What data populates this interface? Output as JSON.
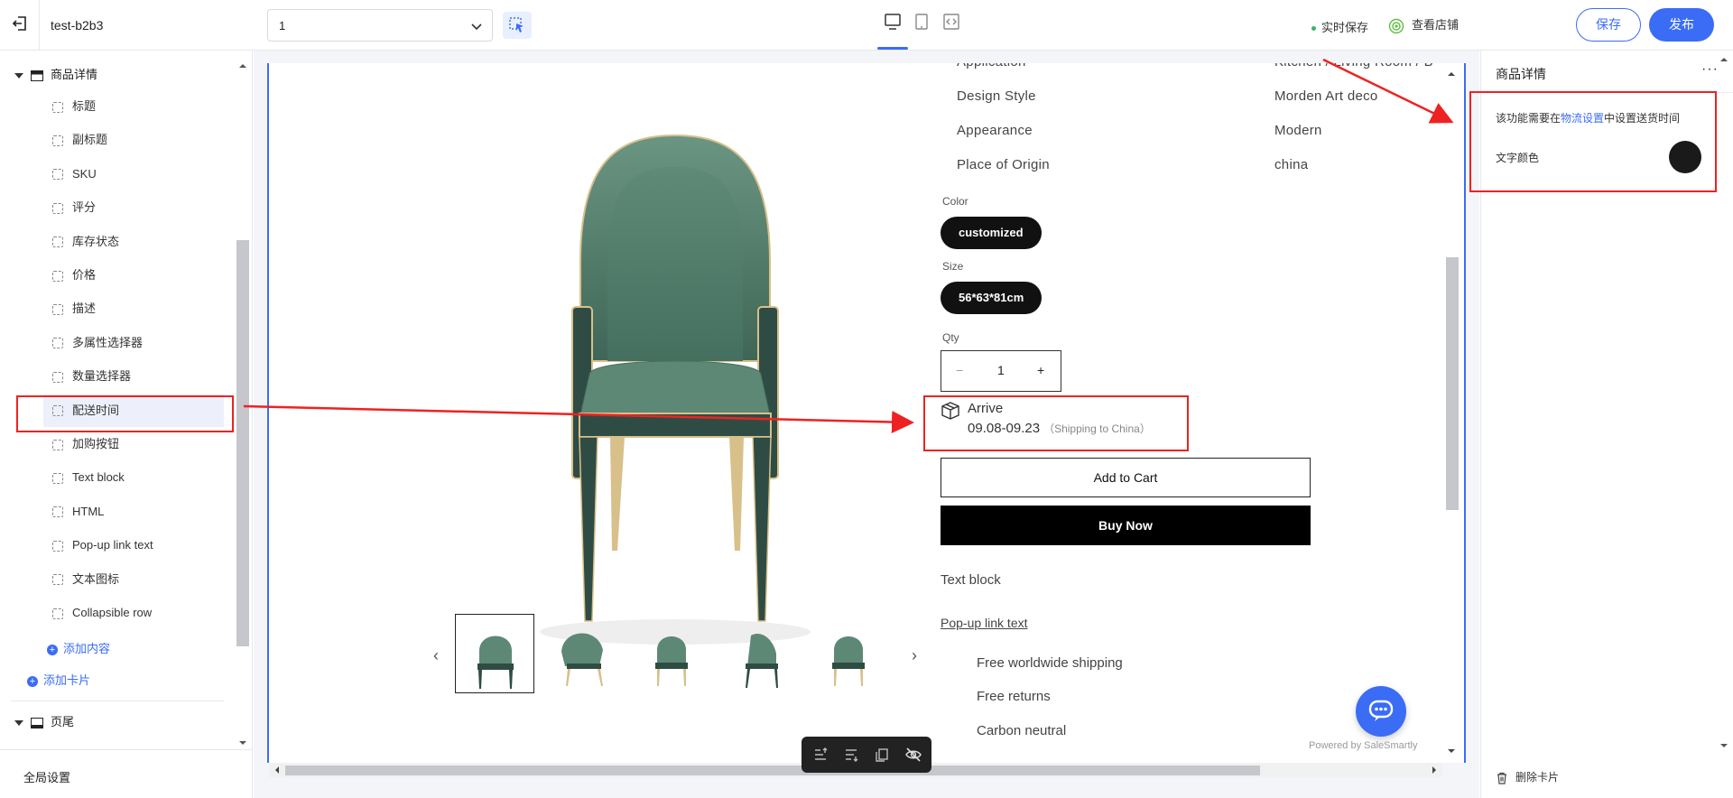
{
  "topbar": {
    "store_name": "test-b2b3",
    "page_select_value": "1",
    "autosave_label": "实时保存",
    "view_store_label": "查看店铺",
    "save_label": "保存",
    "publish_label": "发布"
  },
  "sidebar": {
    "section_product": "商品详情",
    "items": [
      {
        "label": "标题"
      },
      {
        "label": "副标题"
      },
      {
        "label": "SKU"
      },
      {
        "label": "评分"
      },
      {
        "label": "库存状态"
      },
      {
        "label": "价格"
      },
      {
        "label": "描述"
      },
      {
        "label": "多属性选择器"
      },
      {
        "label": "数量选择器"
      },
      {
        "label": "配送时间",
        "active": true
      },
      {
        "label": "加购按钮"
      },
      {
        "label": "Text block"
      },
      {
        "label": "HTML"
      },
      {
        "label": "Pop-up link text"
      },
      {
        "label": "文本图标"
      },
      {
        "label": "Collapsible row"
      }
    ],
    "add_content": "添加内容",
    "add_card": "添加卡片",
    "section_footer": "页尾",
    "global_settings": "全局设置"
  },
  "preview": {
    "specs": [
      {
        "key": "Application",
        "value": "Kitchen / Living Room / B"
      },
      {
        "key": "Design Style",
        "value": "Morden Art deco"
      },
      {
        "key": "Appearance",
        "value": "Modern"
      },
      {
        "key": "Place of Origin",
        "value": "china"
      }
    ],
    "color_label": "Color",
    "color_value": "customized",
    "size_label": "Size",
    "size_value": "56*63*81cm",
    "qty_label": "Qty",
    "qty_minus": "−",
    "qty_value": "1",
    "qty_plus": "+",
    "arrive_title": "Arrive",
    "arrive_date": "09.08-09.23",
    "arrive_note": "（Shipping to China）",
    "add_to_cart": "Add to Cart",
    "buy_now": "Buy Now",
    "text_block": "Text block",
    "popup_link": "Pop-up link text",
    "features": [
      "Free worldwide shipping",
      "Free returns",
      "Carbon neutral"
    ],
    "powered_by": "Powered by SaleSmartly",
    "thumb_prev": "‹",
    "thumb_next": "›"
  },
  "right_panel": {
    "title": "商品详情",
    "more": "···",
    "hint_prefix": "该功能需要在",
    "hint_link": "物流设置",
    "hint_suffix": "中设置送货时间",
    "text_color_label": "文字颜色",
    "text_color_value": "#1a1a1a",
    "delete_card": "删除卡片"
  },
  "colors": {
    "accent": "#3b6cf6",
    "annotation": "#ee2222",
    "chair_green": "#4f7b6a",
    "chair_gold": "#d8c08a"
  }
}
